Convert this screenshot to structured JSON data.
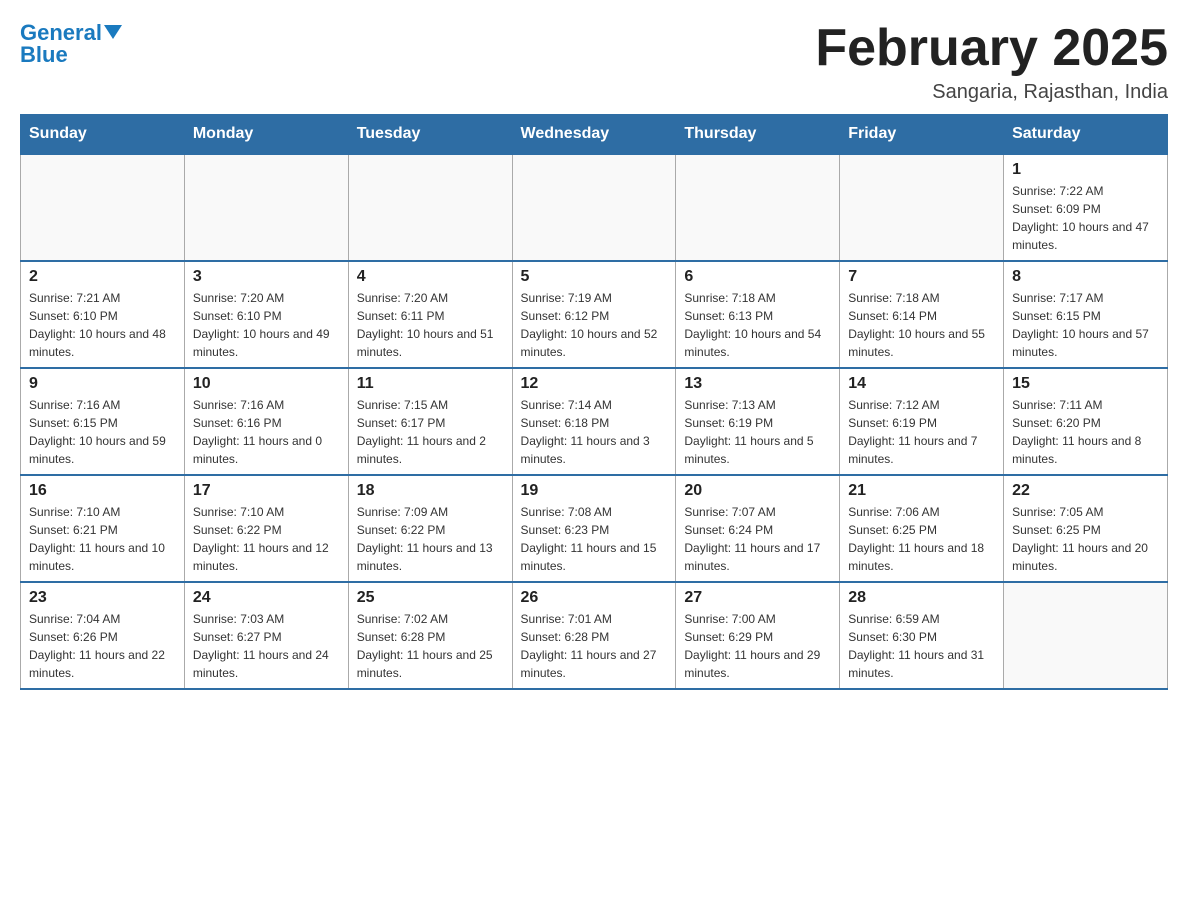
{
  "logo": {
    "general": "General",
    "blue": "Blue"
  },
  "title": "February 2025",
  "location": "Sangaria, Rajasthan, India",
  "weekdays": [
    "Sunday",
    "Monday",
    "Tuesday",
    "Wednesday",
    "Thursday",
    "Friday",
    "Saturday"
  ],
  "weeks": [
    [
      {
        "day": "",
        "sunrise": "",
        "sunset": "",
        "daylight": ""
      },
      {
        "day": "",
        "sunrise": "",
        "sunset": "",
        "daylight": ""
      },
      {
        "day": "",
        "sunrise": "",
        "sunset": "",
        "daylight": ""
      },
      {
        "day": "",
        "sunrise": "",
        "sunset": "",
        "daylight": ""
      },
      {
        "day": "",
        "sunrise": "",
        "sunset": "",
        "daylight": ""
      },
      {
        "day": "",
        "sunrise": "",
        "sunset": "",
        "daylight": ""
      },
      {
        "day": "1",
        "sunrise": "Sunrise: 7:22 AM",
        "sunset": "Sunset: 6:09 PM",
        "daylight": "Daylight: 10 hours and 47 minutes."
      }
    ],
    [
      {
        "day": "2",
        "sunrise": "Sunrise: 7:21 AM",
        "sunset": "Sunset: 6:10 PM",
        "daylight": "Daylight: 10 hours and 48 minutes."
      },
      {
        "day": "3",
        "sunrise": "Sunrise: 7:20 AM",
        "sunset": "Sunset: 6:10 PM",
        "daylight": "Daylight: 10 hours and 49 minutes."
      },
      {
        "day": "4",
        "sunrise": "Sunrise: 7:20 AM",
        "sunset": "Sunset: 6:11 PM",
        "daylight": "Daylight: 10 hours and 51 minutes."
      },
      {
        "day": "5",
        "sunrise": "Sunrise: 7:19 AM",
        "sunset": "Sunset: 6:12 PM",
        "daylight": "Daylight: 10 hours and 52 minutes."
      },
      {
        "day": "6",
        "sunrise": "Sunrise: 7:18 AM",
        "sunset": "Sunset: 6:13 PM",
        "daylight": "Daylight: 10 hours and 54 minutes."
      },
      {
        "day": "7",
        "sunrise": "Sunrise: 7:18 AM",
        "sunset": "Sunset: 6:14 PM",
        "daylight": "Daylight: 10 hours and 55 minutes."
      },
      {
        "day": "8",
        "sunrise": "Sunrise: 7:17 AM",
        "sunset": "Sunset: 6:15 PM",
        "daylight": "Daylight: 10 hours and 57 minutes."
      }
    ],
    [
      {
        "day": "9",
        "sunrise": "Sunrise: 7:16 AM",
        "sunset": "Sunset: 6:15 PM",
        "daylight": "Daylight: 10 hours and 59 minutes."
      },
      {
        "day": "10",
        "sunrise": "Sunrise: 7:16 AM",
        "sunset": "Sunset: 6:16 PM",
        "daylight": "Daylight: 11 hours and 0 minutes."
      },
      {
        "day": "11",
        "sunrise": "Sunrise: 7:15 AM",
        "sunset": "Sunset: 6:17 PM",
        "daylight": "Daylight: 11 hours and 2 minutes."
      },
      {
        "day": "12",
        "sunrise": "Sunrise: 7:14 AM",
        "sunset": "Sunset: 6:18 PM",
        "daylight": "Daylight: 11 hours and 3 minutes."
      },
      {
        "day": "13",
        "sunrise": "Sunrise: 7:13 AM",
        "sunset": "Sunset: 6:19 PM",
        "daylight": "Daylight: 11 hours and 5 minutes."
      },
      {
        "day": "14",
        "sunrise": "Sunrise: 7:12 AM",
        "sunset": "Sunset: 6:19 PM",
        "daylight": "Daylight: 11 hours and 7 minutes."
      },
      {
        "day": "15",
        "sunrise": "Sunrise: 7:11 AM",
        "sunset": "Sunset: 6:20 PM",
        "daylight": "Daylight: 11 hours and 8 minutes."
      }
    ],
    [
      {
        "day": "16",
        "sunrise": "Sunrise: 7:10 AM",
        "sunset": "Sunset: 6:21 PM",
        "daylight": "Daylight: 11 hours and 10 minutes."
      },
      {
        "day": "17",
        "sunrise": "Sunrise: 7:10 AM",
        "sunset": "Sunset: 6:22 PM",
        "daylight": "Daylight: 11 hours and 12 minutes."
      },
      {
        "day": "18",
        "sunrise": "Sunrise: 7:09 AM",
        "sunset": "Sunset: 6:22 PM",
        "daylight": "Daylight: 11 hours and 13 minutes."
      },
      {
        "day": "19",
        "sunrise": "Sunrise: 7:08 AM",
        "sunset": "Sunset: 6:23 PM",
        "daylight": "Daylight: 11 hours and 15 minutes."
      },
      {
        "day": "20",
        "sunrise": "Sunrise: 7:07 AM",
        "sunset": "Sunset: 6:24 PM",
        "daylight": "Daylight: 11 hours and 17 minutes."
      },
      {
        "day": "21",
        "sunrise": "Sunrise: 7:06 AM",
        "sunset": "Sunset: 6:25 PM",
        "daylight": "Daylight: 11 hours and 18 minutes."
      },
      {
        "day": "22",
        "sunrise": "Sunrise: 7:05 AM",
        "sunset": "Sunset: 6:25 PM",
        "daylight": "Daylight: 11 hours and 20 minutes."
      }
    ],
    [
      {
        "day": "23",
        "sunrise": "Sunrise: 7:04 AM",
        "sunset": "Sunset: 6:26 PM",
        "daylight": "Daylight: 11 hours and 22 minutes."
      },
      {
        "day": "24",
        "sunrise": "Sunrise: 7:03 AM",
        "sunset": "Sunset: 6:27 PM",
        "daylight": "Daylight: 11 hours and 24 minutes."
      },
      {
        "day": "25",
        "sunrise": "Sunrise: 7:02 AM",
        "sunset": "Sunset: 6:28 PM",
        "daylight": "Daylight: 11 hours and 25 minutes."
      },
      {
        "day": "26",
        "sunrise": "Sunrise: 7:01 AM",
        "sunset": "Sunset: 6:28 PM",
        "daylight": "Daylight: 11 hours and 27 minutes."
      },
      {
        "day": "27",
        "sunrise": "Sunrise: 7:00 AM",
        "sunset": "Sunset: 6:29 PM",
        "daylight": "Daylight: 11 hours and 29 minutes."
      },
      {
        "day": "28",
        "sunrise": "Sunrise: 6:59 AM",
        "sunset": "Sunset: 6:30 PM",
        "daylight": "Daylight: 11 hours and 31 minutes."
      },
      {
        "day": "",
        "sunrise": "",
        "sunset": "",
        "daylight": ""
      }
    ]
  ]
}
